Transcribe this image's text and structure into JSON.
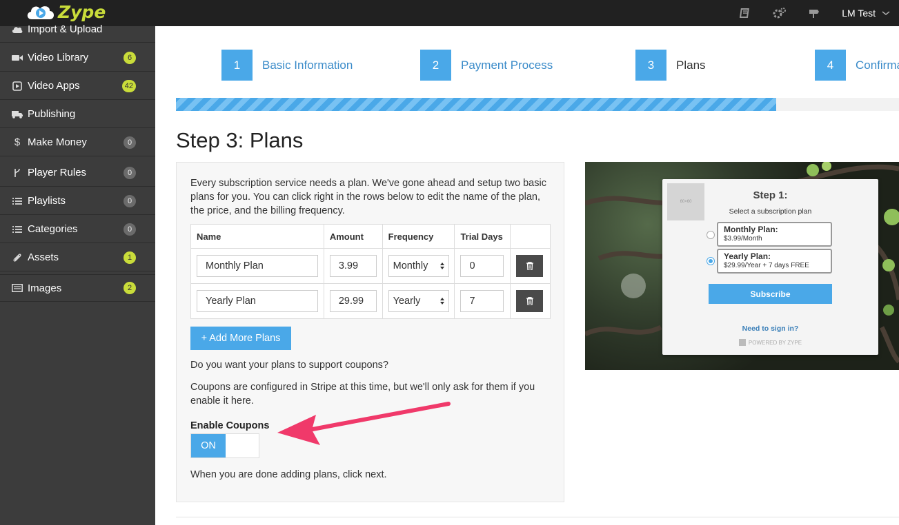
{
  "app": {
    "logo_text": "Zype"
  },
  "header": {
    "icons": [
      "book-icon",
      "gears-icon",
      "sign-icon"
    ],
    "user_name": "LM Test"
  },
  "sidebar": {
    "items": [
      {
        "label": "Import & Upload",
        "icon": "cloud-upload-icon",
        "badge": ""
      },
      {
        "label": "Video Library",
        "icon": "video-camera-icon",
        "badge": "6"
      },
      {
        "label": "Video Apps",
        "icon": "play-square-icon",
        "badge": "42"
      },
      {
        "label": "Publishing",
        "icon": "truck-icon",
        "badge": ""
      },
      {
        "label": "Make Money",
        "icon": "dollar-icon",
        "badge": "0"
      },
      {
        "label": "Player Rules",
        "icon": "fork-icon",
        "badge": "0"
      },
      {
        "label": "Playlists",
        "icon": "list-icon",
        "badge": "0"
      },
      {
        "label": "Categories",
        "icon": "list-icon",
        "badge": "0"
      },
      {
        "label": "Assets",
        "icon": "paperclip-icon",
        "badge": "1"
      },
      {
        "label": "Images",
        "icon": "image-icon",
        "badge": "2"
      }
    ]
  },
  "wizard": {
    "steps": [
      {
        "num": "1",
        "label": "Basic Information"
      },
      {
        "num": "2",
        "label": "Payment Process"
      },
      {
        "num": "3",
        "label": "Plans"
      },
      {
        "num": "4",
        "label": "Confirma"
      }
    ],
    "progress": 0.83,
    "title": "Step 3: Plans"
  },
  "plans": {
    "intro": "Every subscription service needs a plan. We've gone ahead and setup two basic plans for you. You can click right in the rows below to edit the name of the plan, the price, and the billing frequency.",
    "columns": [
      "Name",
      "Amount",
      "Frequency",
      "Trial Days",
      ""
    ],
    "rows": [
      {
        "name": "Monthly Plan",
        "amount": "3.99",
        "frequency": "Monthly",
        "trial_days": "0"
      },
      {
        "name": "Yearly Plan",
        "amount": "29.99",
        "frequency": "Yearly",
        "trial_days": "7"
      }
    ],
    "add_button": "+ Add More Plans",
    "coupon_question": "Do you want your plans to support coupons?",
    "coupon_note": "Coupons are configured in Stripe at this time, but we'll only ask for them if you enable it here.",
    "enable_coupons_label": "Enable Coupons",
    "toggle_state": "ON",
    "done_note": "When you are done adding plans, click next."
  },
  "preview": {
    "thumb_text": "60×60",
    "title": "Step 1:",
    "subtitle": "Select a subscription plan",
    "options": [
      {
        "title": "Monthly Plan:",
        "price": "$3.99/Month",
        "selected": false
      },
      {
        "title": "Yearly Plan:",
        "price": "$29.99/Year + 7 days FREE",
        "selected": true
      }
    ],
    "subscribe_button": "Subscribe",
    "sign_in": "Need to sign in?",
    "powered_by": "POWERED BY ZYPE"
  },
  "colors": {
    "accent": "#4aa8e8",
    "sidebar_bg": "#3c3c3c",
    "topbar_bg": "#212121",
    "badge_yellow": "#c9dc3a",
    "arrow": "#f0396a"
  }
}
